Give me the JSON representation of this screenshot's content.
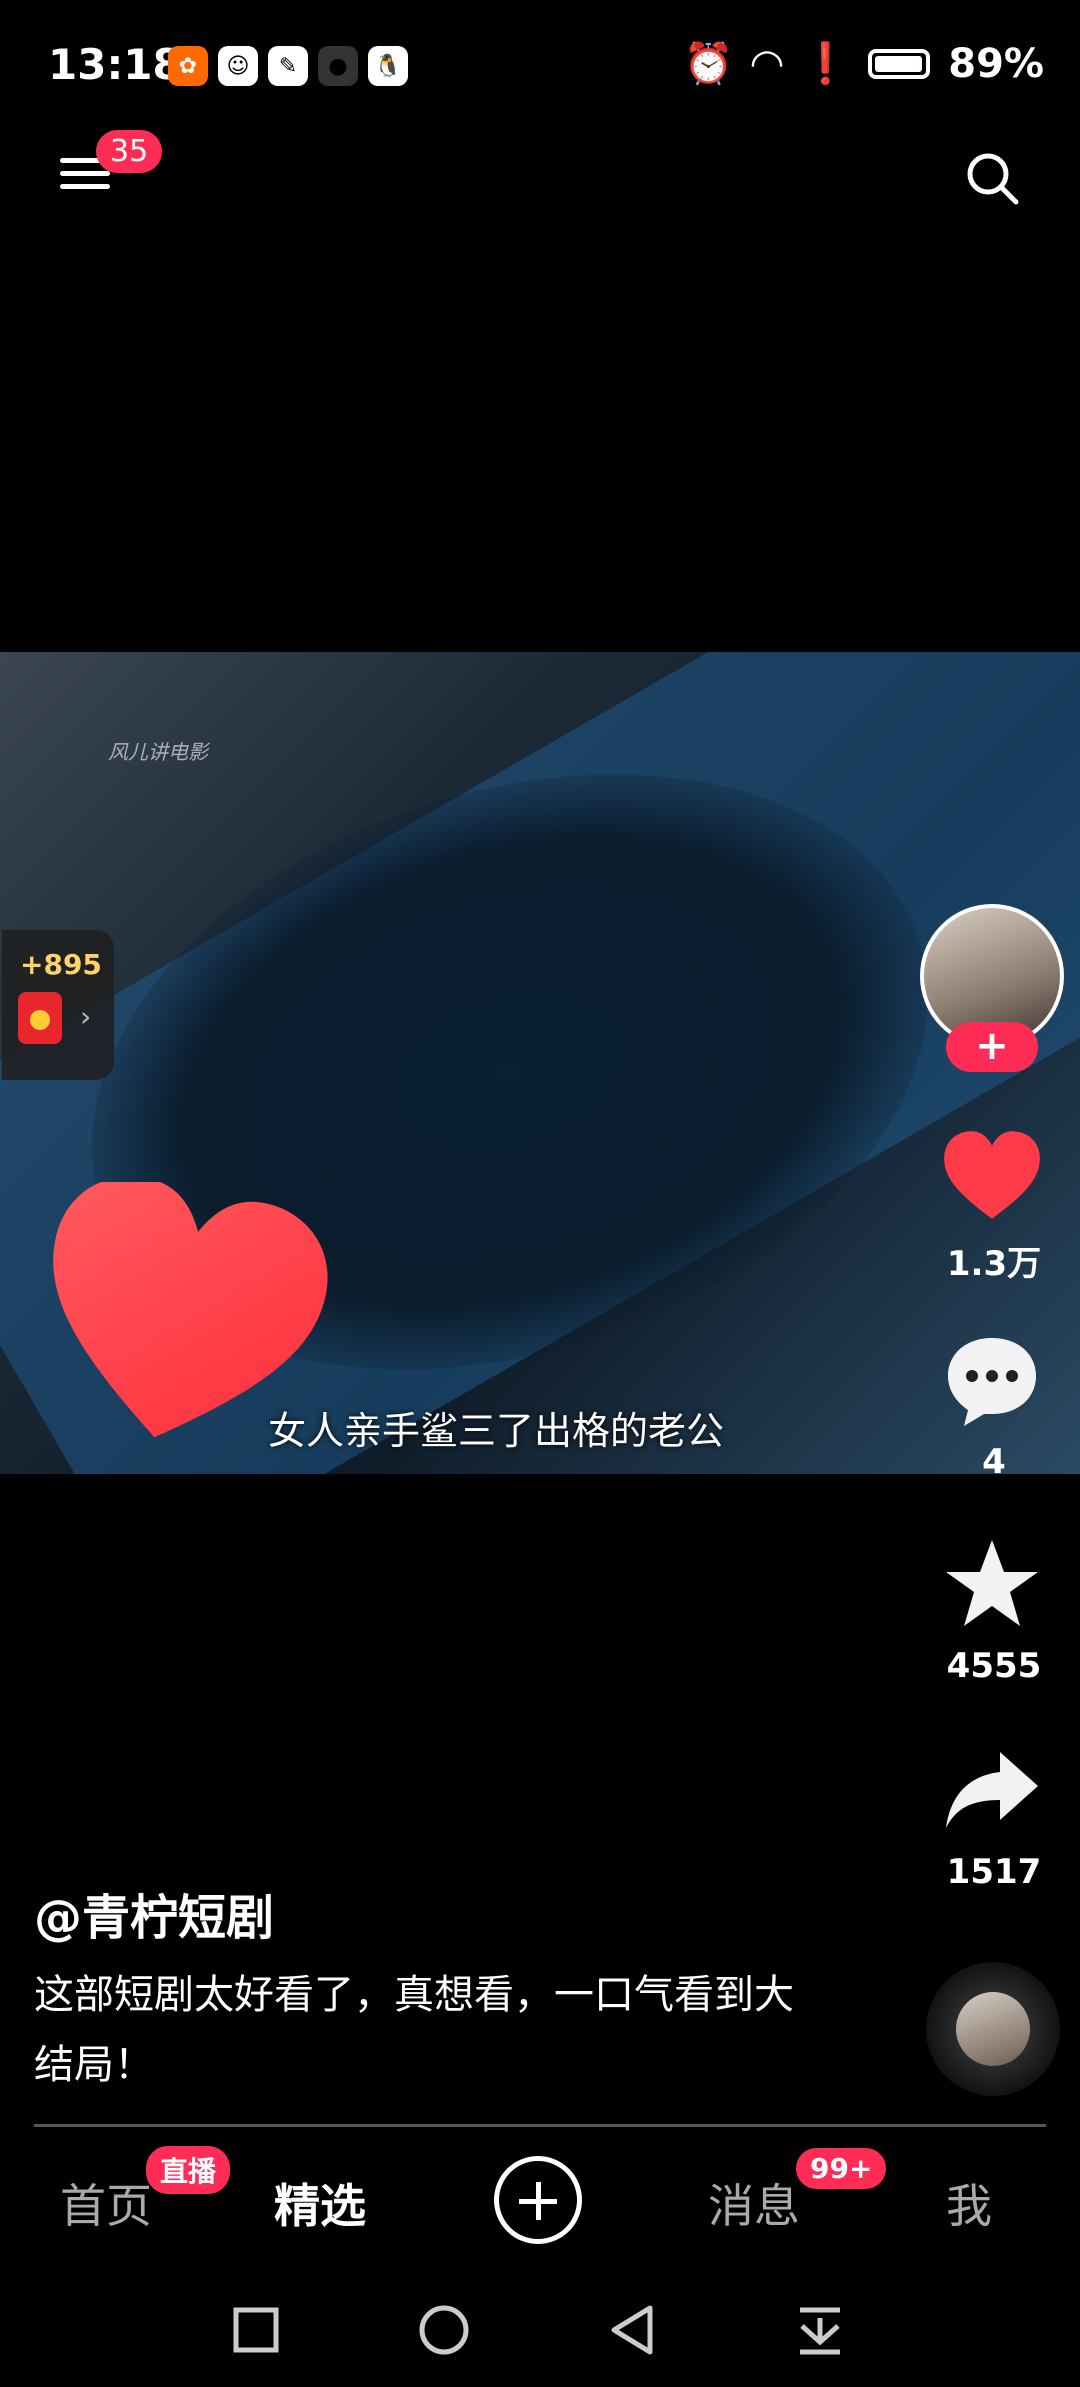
{
  "status_bar": {
    "time": "13:18",
    "battery": "89%",
    "app_icons": [
      "taobao-icon",
      "assistant-icon",
      "notes-icon",
      "camera-icon",
      "qq-icon"
    ]
  },
  "top_bar": {
    "menu_badge": "35"
  },
  "video": {
    "watermark": "风儿讲电影",
    "subtitle": "女人亲手鲨三了出格的老公"
  },
  "reward": {
    "count": "+895"
  },
  "actions": {
    "likes": "1.3万",
    "comments": "4",
    "favorites": "4555",
    "shares": "1517"
  },
  "post": {
    "author": "@青柠短剧",
    "description": "这部短剧太好看了，真想看，一口气看到大结局！"
  },
  "tabs": {
    "home": "首页",
    "home_badge": "直播",
    "featured": "精选",
    "messages": "消息",
    "messages_badge": "99+",
    "me": "我"
  },
  "colors": {
    "accent": "#ff2d55",
    "reward_text": "#ffd36a"
  }
}
